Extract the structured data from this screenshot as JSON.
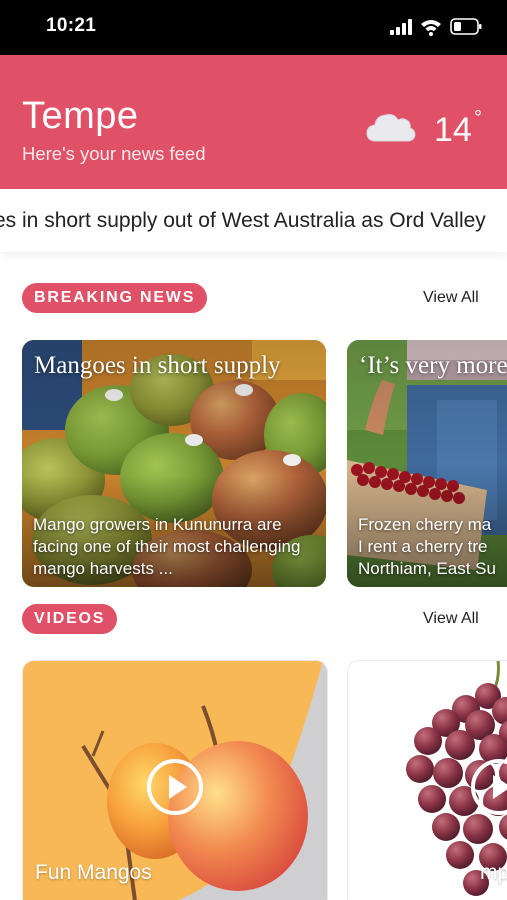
{
  "status": {
    "time": "10:21"
  },
  "header": {
    "city": "Tempe",
    "subtitle": "Here's your news feed",
    "weather_icon": "cloud-icon",
    "temperature": "14",
    "degree_symbol": "°",
    "bg_color": "#e05066"
  },
  "ticker": {
    "text": "es in short supply out of West Australia as Ord Valley"
  },
  "breaking": {
    "label": "BREAKING NEWS",
    "view_all": "View All",
    "cards": [
      {
        "title": "Mangoes in short supply",
        "description": "Mango growers in Kununurra are facing one of their most challenging mango harvests ..."
      },
      {
        "title": "‘It’s very more",
        "description_lines": [
          "Frozen cherry ma",
          "I rent a cherry tre",
          "Northiam, East Su"
        ]
      }
    ]
  },
  "videos": {
    "label": "VIDEOS",
    "view_all": "View All",
    "cards": [
      {
        "title": "Fun Mangos"
      },
      {
        "title": "mp"
      }
    ]
  }
}
